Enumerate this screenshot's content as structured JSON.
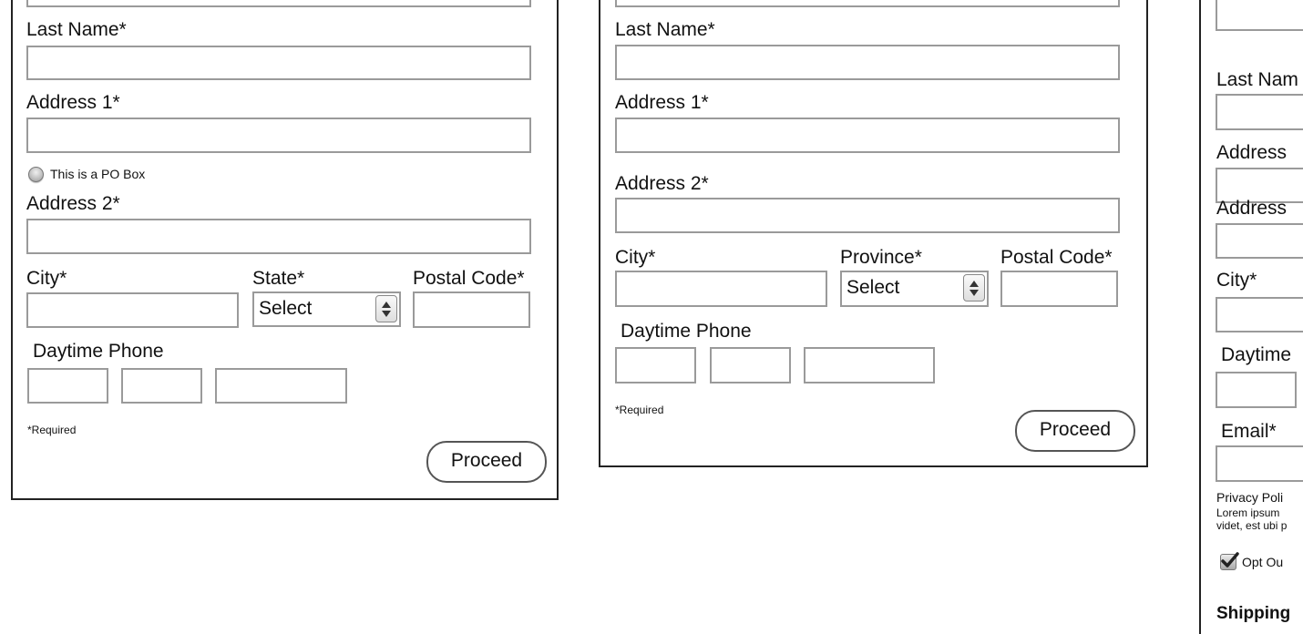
{
  "form_common": {
    "last_name_label": "Last Name*",
    "address1_label": "Address 1*",
    "address2_label": "Address 2*",
    "city_label": "City*",
    "daytime_phone_label": "Daytime Phone",
    "required_note": "*Required",
    "proceed_button": "Proceed",
    "select_value": "Select"
  },
  "form_us": {
    "po_box_label": "This is a PO Box",
    "state_label": "State*",
    "postal_label": "Postal Code*"
  },
  "form_ca": {
    "province_label": "Province*",
    "postal_label": "Postal Code*"
  },
  "form_partial": {
    "last_name_label": "Last Nam",
    "address1_label": "Address",
    "address2_label": "Address ",
    "city_label": "City*",
    "daytime_label": "Daytime",
    "email_label": "Email*",
    "privacy_title": "Privacy Poli",
    "privacy_line1": "Lorem ipsum",
    "privacy_line2": "videt, est ubi p",
    "opt_out_label": "Opt Ou",
    "shipping_heading": "Shipping"
  },
  "icons": {
    "po_box_radio": "radio-icon",
    "select_arrows": "up-down-arrows-icon",
    "opt_out_checkbox": "checkmark-icon"
  }
}
